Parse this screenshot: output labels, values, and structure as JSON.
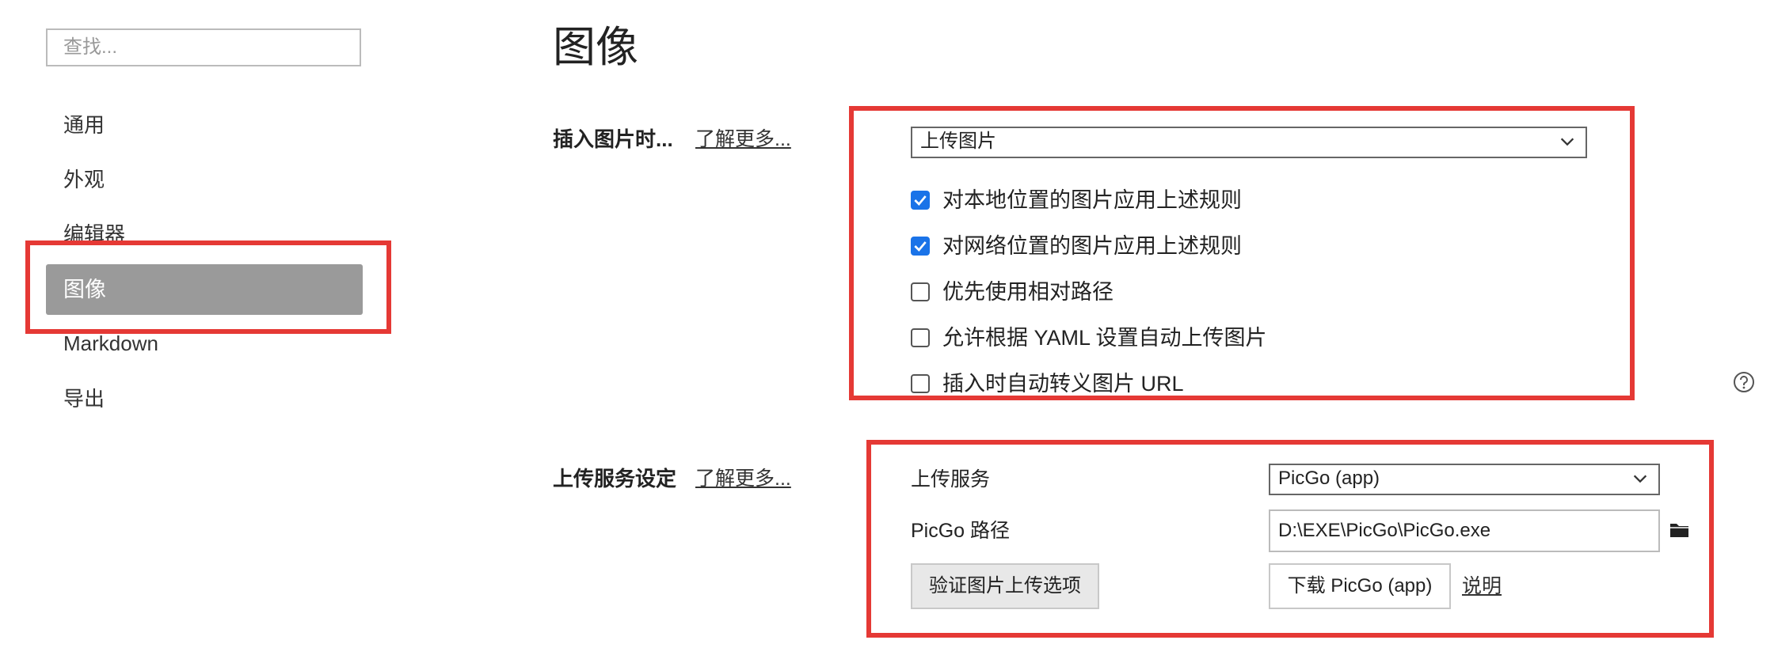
{
  "sidebar": {
    "search_placeholder": "查找...",
    "items": [
      {
        "label": "通用"
      },
      {
        "label": "外观"
      },
      {
        "label": "编辑器"
      },
      {
        "label": "图像"
      },
      {
        "label": "Markdown"
      },
      {
        "label": "导出"
      }
    ],
    "active_index": 3
  },
  "page": {
    "title": "图像"
  },
  "insert_section": {
    "label": "插入图片时...",
    "learn_more": "了解更多...",
    "action_select": "上传图片",
    "options": [
      {
        "label": "对本地位置的图片应用上述规则",
        "checked": true
      },
      {
        "label": "对网络位置的图片应用上述规则",
        "checked": true
      },
      {
        "label": "优先使用相对路径",
        "checked": false
      },
      {
        "label": "允许根据 YAML 设置自动上传图片",
        "checked": false
      },
      {
        "label": "插入时自动转义图片 URL",
        "checked": false
      }
    ]
  },
  "upload_section": {
    "label": "上传服务设定",
    "learn_more": "了解更多...",
    "service_label": "上传服务",
    "service_value": "PicGo (app)",
    "path_label": "PicGo 路径",
    "path_value": "D:\\EXE\\PicGo\\PicGo.exe",
    "verify_button": "验证图片上传选项",
    "download_button": "下载 PicGo (app)",
    "help_link": "说明"
  },
  "icons": {
    "help": "question-circle-icon",
    "folder": "folder-icon",
    "dropdown": "chevron-down-icon"
  },
  "colors": {
    "accent": "#1a73e8",
    "active_nav_bg": "#9a9a9a",
    "annotation": "#e53935"
  }
}
